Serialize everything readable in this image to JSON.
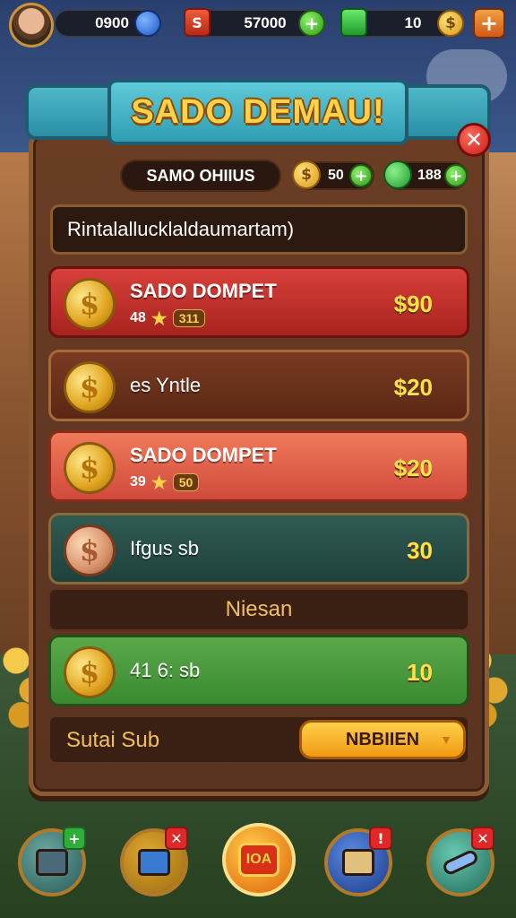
{
  "hud": {
    "currency_1": "0900",
    "currency_2": "57000",
    "currency_3": "10",
    "currency_2_icon": "S"
  },
  "panel": {
    "title": "SADO DEMAU!",
    "close_label": "✕",
    "resource_label": "SAMO OHIIUS",
    "coin_chip_value": "50",
    "gem_chip_value": "188",
    "search_text": "Rintalallucklaldaumartam)"
  },
  "rows": [
    {
      "title": "SADO DOMPET",
      "sub_num": "48",
      "tag": "311",
      "price": "$90",
      "icon": "gold-coin-icon"
    },
    {
      "title": "es Yntle",
      "price": "$20",
      "icon": "gold-coin-icon"
    },
    {
      "title": "SADO DOMPET",
      "sub_num": "39",
      "tag": "50",
      "price": "$20",
      "icon": "gold-coin-icon"
    },
    {
      "title": "Ifgus sb",
      "price": "30",
      "icon": "bronze-coin-icon"
    },
    {
      "title": "41 6: sb",
      "price": "10",
      "icon": "gold-coin-icon"
    }
  ],
  "section_label": "Niesan",
  "footer": {
    "label": "Sutai Sub",
    "button_label": "NBBIIEN"
  },
  "nav": {
    "shop_label": "IOA"
  },
  "colors": {
    "title_gold": "#ffd24a",
    "banner_teal": "#2a8fa4",
    "panel_brown": "#5a3320",
    "price_yellow": "#ffe24a"
  }
}
